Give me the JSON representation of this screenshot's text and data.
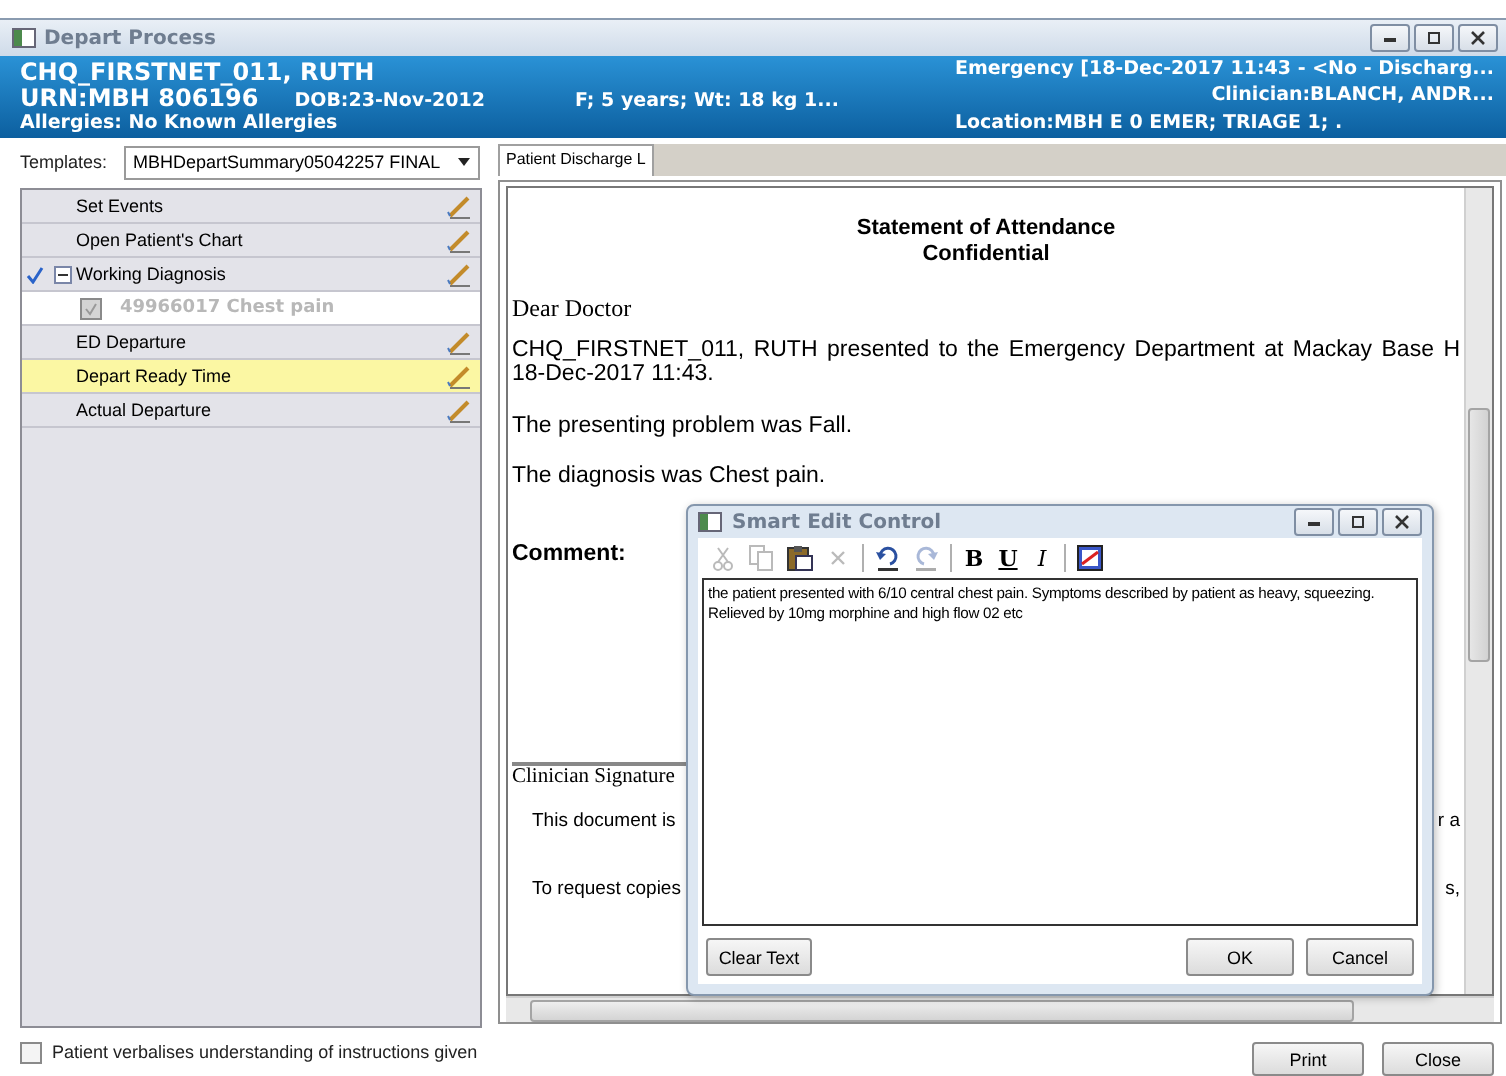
{
  "window": {
    "title": "Depart Process"
  },
  "patient": {
    "name": "CHQ_FIRSTNET_011, RUTH",
    "urn": "URN:MBH 806196",
    "dob": "DOB:23-Nov-2012",
    "demographics": "F; 5 years; Wt: 18 kg 1...",
    "allergies": "Allergies: No Known Allergies",
    "encounter": "Emergency [18-Dec-2017 11:43 - <No - Discharg...",
    "clinician": "Clinician:BLANCH, ANDR...",
    "location": "Location:MBH E 0 EMER; TRIAGE 1; ."
  },
  "templates": {
    "label": "Templates:",
    "value": "MBHDepartSummary05042257 FINAL"
  },
  "tasks": [
    {
      "label": "Set Events",
      "selected": false,
      "checked": false
    },
    {
      "label": "Open Patient's Chart",
      "selected": false,
      "checked": false
    },
    {
      "label": "Working Diagnosis",
      "selected": false,
      "checked": true,
      "expanded": true,
      "children": [
        {
          "label": "49966017 Chest pain",
          "checked": true,
          "disabled": true
        }
      ]
    },
    {
      "label": "ED Departure",
      "selected": false,
      "checked": false
    },
    {
      "label": "Depart Ready Time",
      "selected": true,
      "checked": false
    },
    {
      "label": "Actual Departure",
      "selected": false,
      "checked": false
    }
  ],
  "tabs": [
    {
      "label": "Patient Discharge L",
      "selected": true
    }
  ],
  "document": {
    "title": "Statement of Attendance",
    "subtitle": "Confidential",
    "salutation": "Dear Doctor",
    "presentation_lines": [
      "CHQ_FIRSTNET_011, RUTH presented to the Emergency Department at Mackay Base H",
      "18-Dec-2017 11:43."
    ],
    "problem": "The presenting problem was Fall.",
    "diagnosis": "The diagnosis was Chest pain.",
    "comment_label": "Comment:",
    "signature_label": "Clinician Signature",
    "notices": [
      {
        "left": "This document is",
        "right": "r a"
      },
      {
        "left": "To request copies",
        "right": "s,"
      }
    ]
  },
  "dialog": {
    "title": "Smart Edit Control",
    "toolbar": [
      {
        "kind": "cut",
        "disabled": true
      },
      {
        "kind": "copy",
        "disabled": true
      },
      {
        "kind": "paste",
        "disabled": false
      },
      {
        "kind": "delete",
        "disabled": true
      },
      {
        "kind": "separator"
      },
      {
        "kind": "undo",
        "disabled": false
      },
      {
        "kind": "redo",
        "disabled": true
      },
      {
        "kind": "separator"
      },
      {
        "kind": "bold",
        "label": "B"
      },
      {
        "kind": "underline",
        "label": "U"
      },
      {
        "kind": "italic",
        "label": "I"
      },
      {
        "kind": "separator"
      },
      {
        "kind": "spellcheck",
        "disabled": false
      }
    ],
    "text": "the patient presented with 6/10 central chest pain. Symptoms described by patient as heavy, squeezing. Relieved by 10mg morphine and high flow 02 etc",
    "left_buttons": [
      "Clear Text"
    ],
    "right_buttons": [
      "OK",
      "Cancel"
    ]
  },
  "acknowledgement": {
    "label": "Patient verbalises understanding of instructions given",
    "checked": false
  },
  "buttons": [
    "Print",
    "Close"
  ]
}
